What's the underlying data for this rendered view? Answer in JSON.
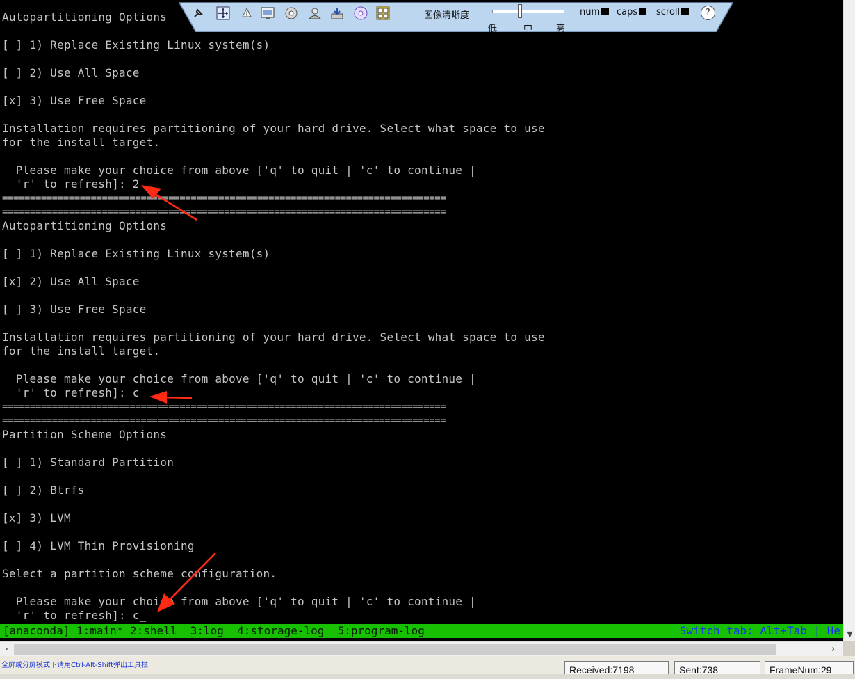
{
  "toolbar": {
    "clarity_label": "图像清晰度",
    "clarity_low": "低",
    "clarity_mid": "中",
    "clarity_high": "高",
    "num_label": "num",
    "caps_label": "caps",
    "scroll_label": "scroll",
    "help_glyph": "?",
    "icons": [
      "pin-icon",
      "move-icon",
      "up-arrow-icon",
      "screenshot-icon",
      "disc-icon",
      "user-icon",
      "install-icon",
      "cd-icon",
      "keyboard-icon"
    ]
  },
  "terminal": {
    "lines": [
      "Autopartitioning Options",
      "[ ] 1) Replace Existing Linux system(s)",
      "[ ] 2) Use All Space",
      "[x] 3) Use Free Space",
      "Installation requires partitioning of your hard drive. Select what space to use",
      "for the install target.",
      "  Please make your choice from above ['q' to quit | 'c' to continue |",
      "  'r' to refresh]: 2",
      "================================================================================",
      "================================================================================",
      "Autopartitioning Options",
      "[ ] 1) Replace Existing Linux system(s)",
      "[x] 2) Use All Space",
      "[ ] 3) Use Free Space",
      "Installation requires partitioning of your hard drive. Select what space to use",
      "for the install target.",
      "  Please make your choice from above ['q' to quit | 'c' to continue |",
      "  'r' to refresh]: c",
      "================================================================================",
      "================================================================================",
      "Partition Scheme Options",
      "[ ] 1) Standard Partition",
      "[ ] 2) Btrfs",
      "[x] 3) LVM",
      "[ ] 4) LVM Thin Provisioning",
      "Select a partition scheme configuration.",
      "  Please make your choice from above ['q' to quit | 'c' to continue |",
      "  'r' to refresh]: c_"
    ],
    "status_left": "[anaconda] 1:main* 2:shell  3:log  4:storage-log  5:program-log",
    "status_right": "Switch tab: Alt+Tab | He"
  },
  "bottom": {
    "hint": "全屏或分屏模式下请用Ctrl-Alt-Shift弹出工具栏",
    "received": "Received:7198",
    "sent": "Sent:738",
    "framenum": "FrameNum:29"
  },
  "colors": {
    "terminal_bg": "#000000",
    "terminal_fg": "#c6c6c6",
    "status_bar": "#17c000",
    "toolbar_bg": "#bcd6f0",
    "annotation_arrow": "#ff2a14"
  }
}
